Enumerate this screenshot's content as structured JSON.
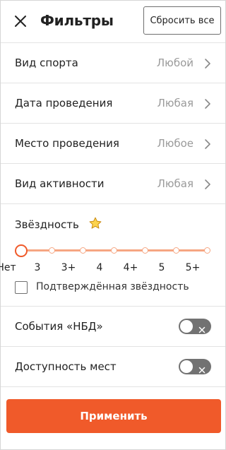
{
  "header": {
    "title": "Фильтры",
    "reset_label": "Сбросить все",
    "close_icon": "close-icon"
  },
  "filters": [
    {
      "label": "Вид спорта",
      "value": "Любой"
    },
    {
      "label": "Дата проведения",
      "value": "Любая"
    },
    {
      "label": "Место проведения",
      "value": "Любое"
    },
    {
      "label": "Вид активности",
      "value": "Любая"
    }
  ],
  "stars": {
    "title": "Звёздность",
    "icon": "star-icon",
    "ticks": [
      "Нет",
      "3",
      "3+",
      "4",
      "4+",
      "5",
      "5+"
    ],
    "selected": "Нет",
    "confirmed_label": "Подтверждённая звёздность",
    "confirmed_checked": false
  },
  "toggles": [
    {
      "label": "События «НБД»",
      "on": false
    },
    {
      "label": "Доступность мест",
      "on": false
    }
  ],
  "apply_label": "Применить",
  "colors": {
    "accent": "#f05a2a",
    "slider_track": "#f6a682",
    "toggle_off": "#727272",
    "muted_text": "#9a9a9a",
    "divider": "#e3e3e3"
  }
}
